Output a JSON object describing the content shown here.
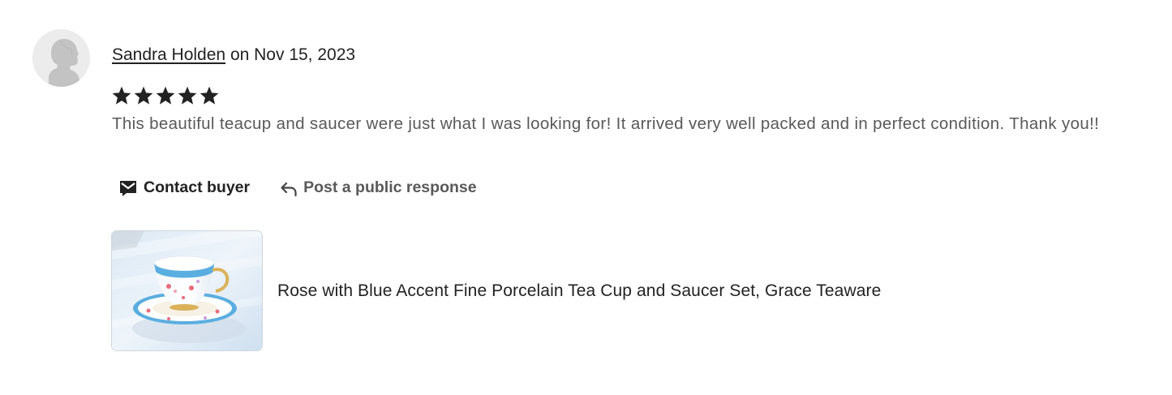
{
  "review": {
    "reviewer_name": "Sandra Holden",
    "date_text": " on Nov 15, 2023",
    "rating": 5,
    "rating_max": 5,
    "text": "This beautiful teacup and saucer were just what I was looking for! It arrived very well packed and in perfect condition. Thank you!!"
  },
  "actions": {
    "contact_buyer": "Contact buyer",
    "post_response": "Post a public response"
  },
  "listing": {
    "title": "Rose with Blue Accent Fine Porcelain Tea Cup and Saucer Set, Grace Teaware"
  },
  "icons": {
    "avatar": "default-avatar-silhouette-icon",
    "star": "star-icon",
    "contact": "envelope-icon",
    "response": "reply-arrow-icon"
  },
  "colors": {
    "text_primary": "#222222",
    "text_secondary": "#595959",
    "star": "#222222",
    "avatar_bg": "#ececec"
  }
}
